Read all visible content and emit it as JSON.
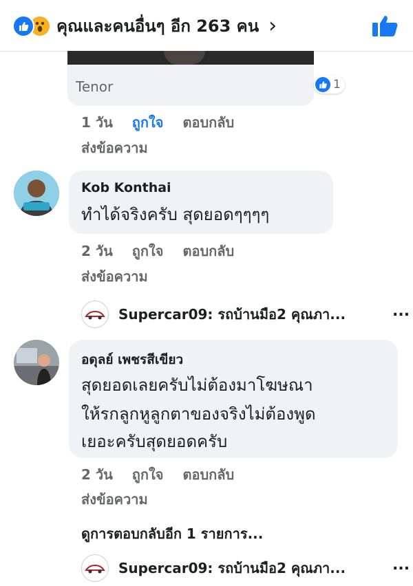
{
  "header": {
    "reaction_summary": "คุณและคนอื่นๆ อีก 263 คน",
    "chevron": "›",
    "like_icon": "thumbs-up-icon"
  },
  "gif_comment": {
    "provider": "Tenor",
    "reaction_count": "1",
    "meta": {
      "time": "1 วัน",
      "like": "ถูกใจ",
      "reply": "ตอบกลับ"
    },
    "send": "ส่งข้อความ"
  },
  "comment1": {
    "author": "Kob Konthai",
    "text": "ทำได้จริงครับ สุดยอดๆๆๆๆ",
    "meta": {
      "time": "2 วัน",
      "like": "ถูกใจ",
      "reply": "ตอบกลับ"
    },
    "send": "ส่งข้อความ",
    "share": {
      "text": "Supercar09: รถบ้านมือ2 คุณภา...",
      "more": "..."
    }
  },
  "comment2": {
    "author": "อดุลย์ เพชรสีเขียว",
    "text_lines": [
      "สุดยอดเลยครับไม่ต้องมาโฆษณา",
      "ให้รกลูกหูลูกตาของจริงไม่ต้องพูด",
      "เยอะครับสุดยอดครับ"
    ],
    "meta": {
      "time": "2 วัน",
      "like": "ถูกใจ",
      "reply": "ตอบกลับ"
    },
    "send": "ส่งข้อความ",
    "more_replies": "ดูการตอบกลับอีก 1 รายการ...",
    "share": {
      "text": "Supercar09: รถบ้านมือ2 คุณภา...",
      "more": "..."
    }
  },
  "colors": {
    "accent": "#1877f2",
    "wow": "#f7b125",
    "bubble": "#f0f2f5",
    "muted": "#65676b"
  }
}
